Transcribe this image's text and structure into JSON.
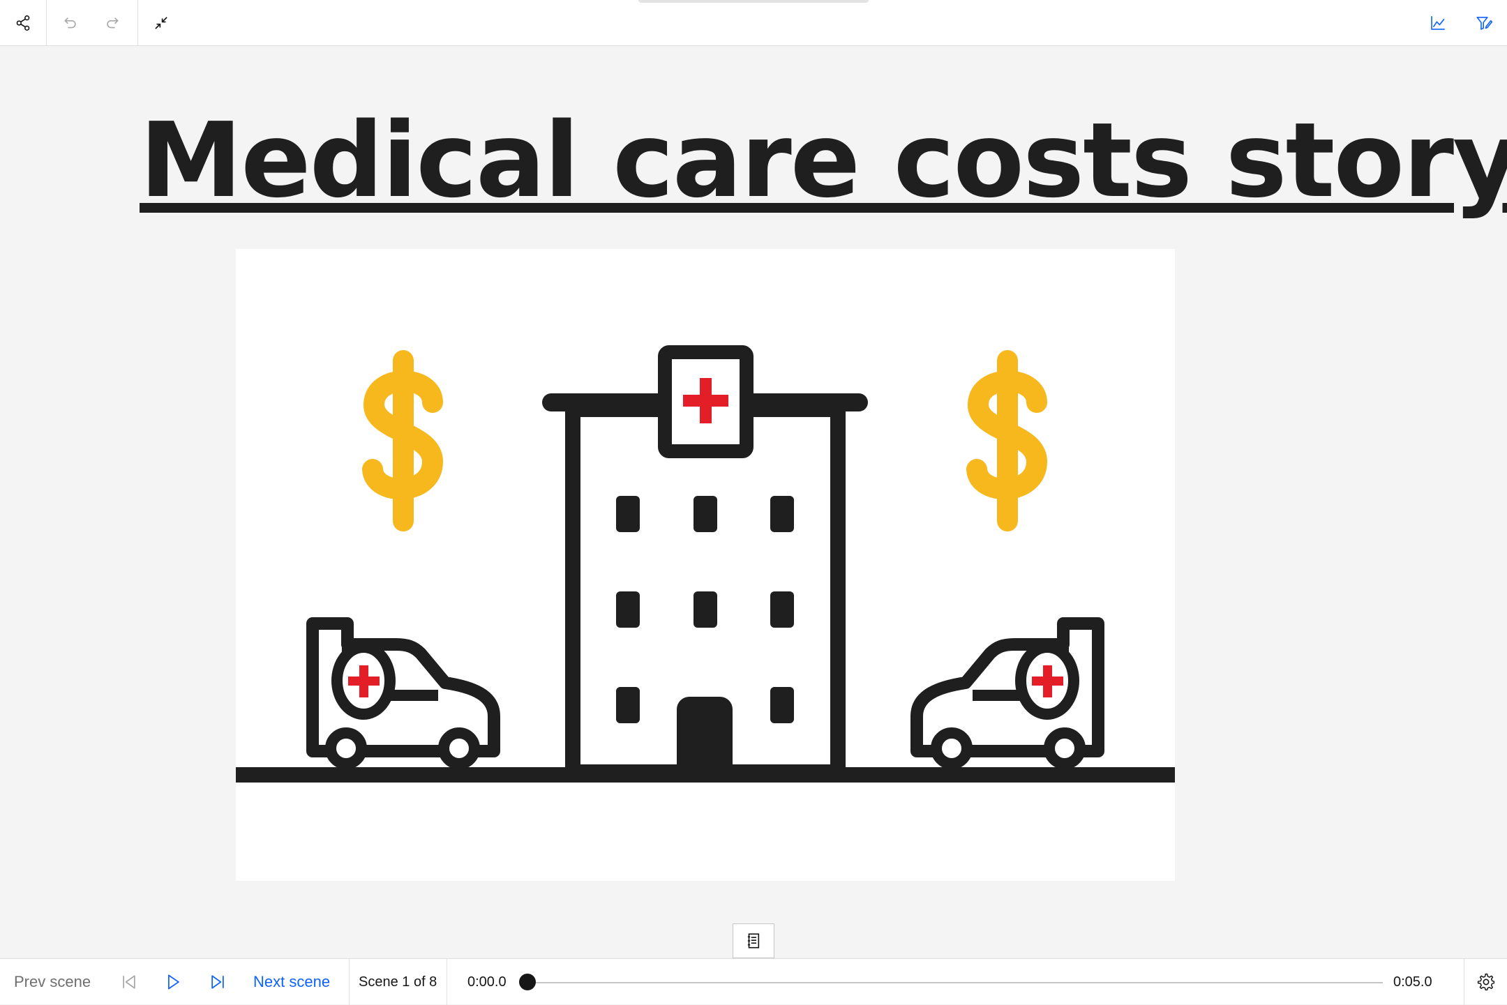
{
  "toolbar": {
    "share_icon": "share-icon",
    "undo_icon": "undo-icon",
    "redo_icon": "redo-icon",
    "collapse_icon": "collapse-icon",
    "chart_icon": "line-chart-icon",
    "filter_icon": "filter-edit-icon"
  },
  "story": {
    "title": "Medical care costs story"
  },
  "illustration": {
    "subject": "hospital with ambulances and dollar signs",
    "colors": {
      "outline": "#1f1f1f",
      "cross": "#e41e26",
      "dollar": "#f6b81c"
    }
  },
  "playbar": {
    "prev_label": "Prev scene",
    "next_label": "Next scene",
    "scene_status": "Scene 1 of 8",
    "time_current": "0:00.0",
    "time_total": "0:05.0",
    "progress": 0.0,
    "accent_color": "#0f62fe"
  }
}
